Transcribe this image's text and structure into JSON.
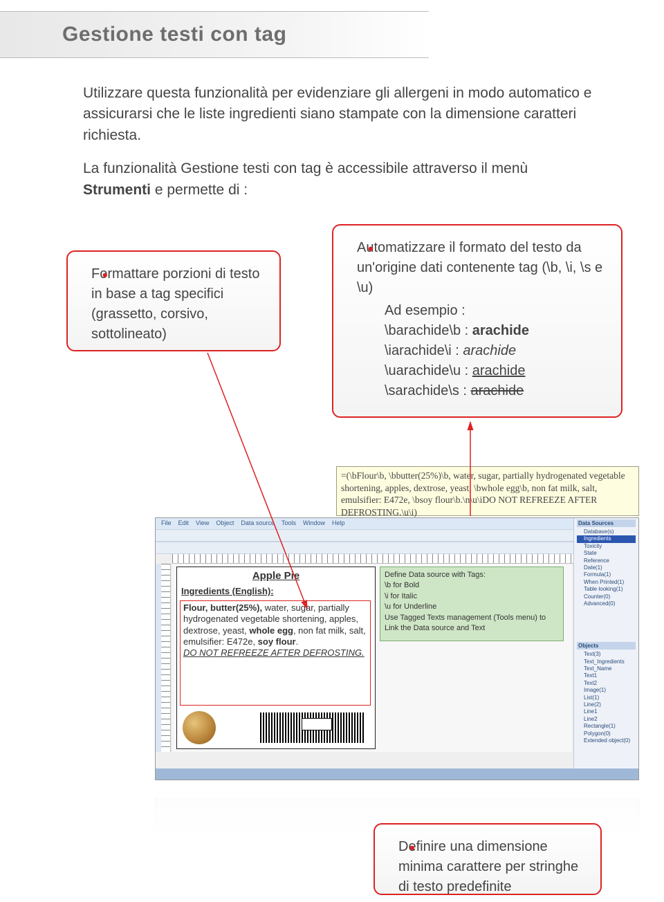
{
  "title": "Gestione testi con tag",
  "intro": {
    "p1": "Utilizzare questa funzionalità per evidenziare gli allergeni in modo automatico e assicurarsi che le liste ingredienti siano stampate con la dimensione caratteri richiesta.",
    "p2_pre": "La funzionalità Gestione testi con tag è accessibile attraverso il menù ",
    "p2_bold": "Strumenti",
    "p2_post": " e permette di :"
  },
  "callout_format": "Formattare porzioni di testo in base a tag specifici (grassetto, corsivo, sottolineato)",
  "callout_auto": {
    "line1": "Automatizzare il formato del testo da un'origine dati contenente tag (\\b, \\i, \\s e \\u)",
    "example_label": "Ad esempio :",
    "b_src": "\\barachide\\b : ",
    "b_out": "arachide",
    "i_src": "\\iarachide\\i : ",
    "i_out": "arachide",
    "u_src": "\\uarachide\\u : ",
    "u_out": "arachide",
    "s_src": "\\sarachide\\s : ",
    "s_out": "arachide"
  },
  "callout_minsize": "Definire una dimensione minima carattere per stringhe di testo predefinite",
  "formula": "=(\\bFlour\\b, \\bbutter(25%)\\b, water, sugar, partially hydrogenated vegetable shortening, apples, dextrose, yeast, \\bwhole egg\\b, non fat milk, salt, emulsifier: E472e, \\bsoy flour\\b.\\n\\u\\iDO NOT REFREEZE AFTER DEFROSTING.\\u\\i)",
  "screenshot": {
    "menubar": [
      "File",
      "Edit",
      "View",
      "Object",
      "Data source",
      "Tools",
      "Window",
      "Help"
    ],
    "label_title": "Apple Pie",
    "label_subtitle": "Ingredients (English):",
    "ingredients_html_parts": {
      "p1_bold1": "Flour, butter(25%),",
      "p1_plain1": " water, sugar, partially hydrogenated vegetable shortening, apples, dextrose, yeast, ",
      "p1_bold2": "whole egg",
      "p1_plain2": ", non fat milk, salt, emulsifier: E472e, ",
      "p1_bold3": "soy flour",
      "p1_plain3": ".",
      "p2_warn": "DO NOT REFREEZE AFTER DEFROSTING."
    },
    "define_box": {
      "l1": "Define Data source with Tags:",
      "l2": "\\b for Bold",
      "l3": "\\i for Italic",
      "l4": "\\u for Underline",
      "l5": "Use Tagged Texts management (Tools menu) to Link the Data source and Text"
    },
    "side_panel": {
      "hdr1": "Data Sources",
      "db_hdr": "Database(s)",
      "db_items": [
        "Ingredients",
        "Toxicity",
        "State",
        "Reference"
      ],
      "groups": [
        "Date(1)",
        "Formula(1)",
        "When Printed(1)",
        "Table looking(1)",
        "Counter(0)",
        "Advanced(0)"
      ],
      "hdr2": "Objects",
      "obj_items": [
        "Text(3)",
        "  Text_Ingredients",
        "  Text_Name",
        "  Text1",
        "  Text2",
        "Image(1)",
        "List(1)",
        "Line(2)",
        "  Line1",
        "  Line2",
        "Rectangle(1)",
        "Polygon(0)",
        "Extended object(0)"
      ]
    }
  }
}
